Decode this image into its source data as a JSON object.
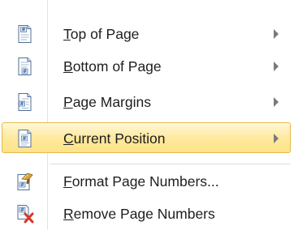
{
  "menu": {
    "items": [
      {
        "label_prefix": "",
        "accel": "T",
        "label_rest": "op of Page",
        "icon": "page-top-number-icon",
        "has_submenu": true
      },
      {
        "label_prefix": "",
        "accel": "B",
        "label_rest": "ottom of Page",
        "icon": "page-bottom-number-icon",
        "has_submenu": true
      },
      {
        "label_prefix": "",
        "accel": "P",
        "label_rest": "age Margins",
        "icon": "page-margin-number-icon",
        "has_submenu": true
      },
      {
        "label_prefix": "",
        "accel": "C",
        "label_rest": "urrent Position",
        "icon": "current-position-number-icon",
        "has_submenu": true,
        "highlighted": true
      },
      {
        "label_prefix": "",
        "accel": "F",
        "label_rest": "ormat Page Numbers...",
        "icon": "format-page-numbers-icon",
        "has_submenu": false
      },
      {
        "label_prefix": "",
        "accel": "R",
        "label_rest": "emove Page Numbers",
        "icon": "remove-page-numbers-icon",
        "has_submenu": false
      }
    ],
    "colors": {
      "highlight_border": "#e6b94a",
      "highlight_fill": "#ffe89a",
      "remove_x": "#d9342b"
    }
  }
}
